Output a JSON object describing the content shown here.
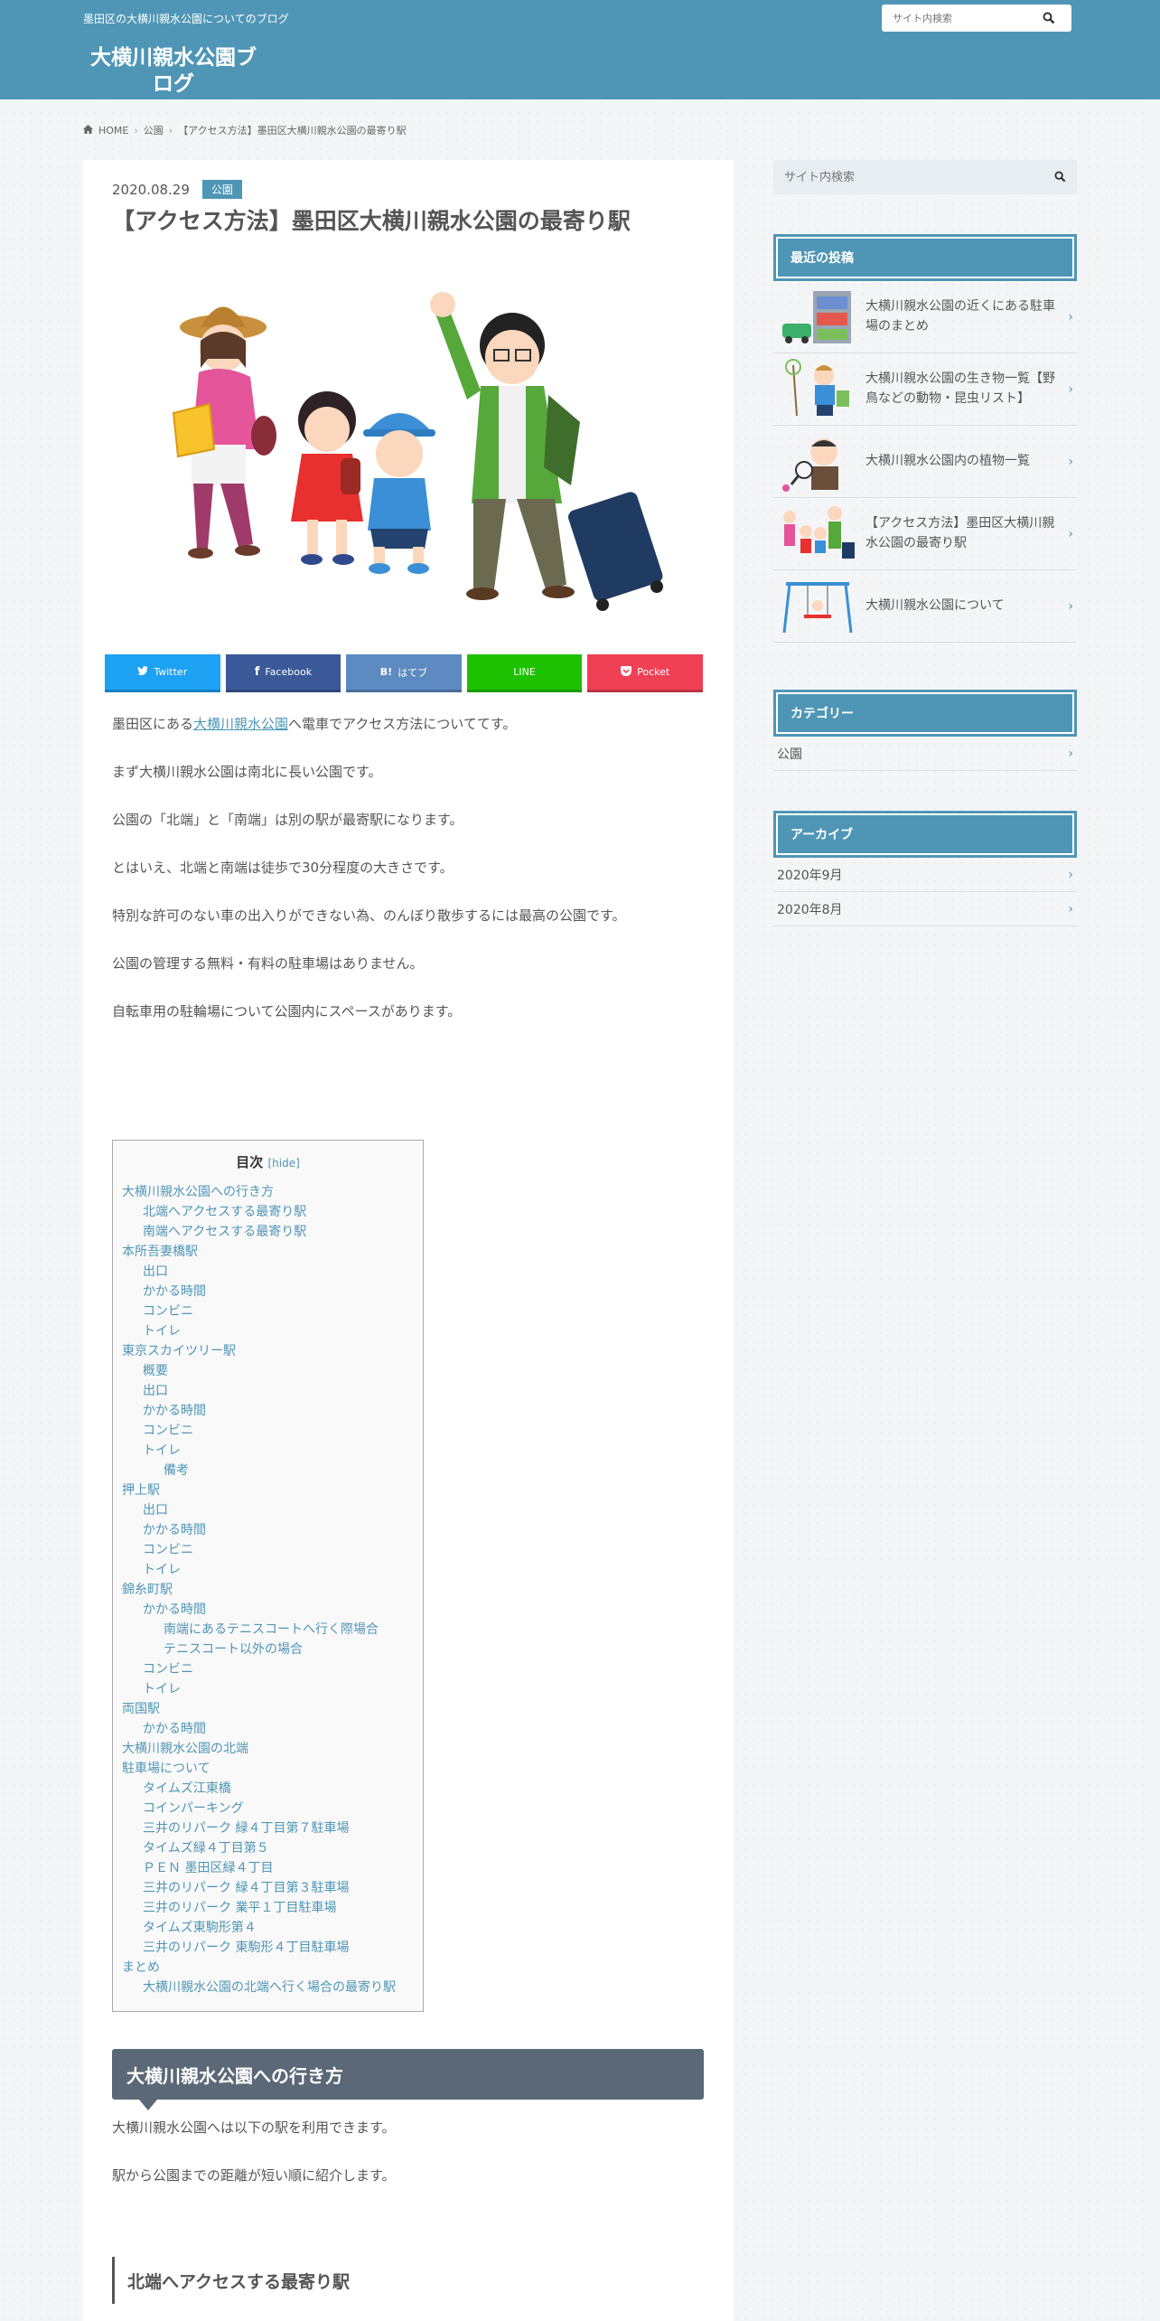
{
  "header": {
    "tagline": "墨田区の大横川親水公園についてのブログ",
    "site_title": "大横川親水公園ブログ",
    "search_placeholder": "サイト内検索"
  },
  "breadcrumb": {
    "home": "HOME",
    "category": "公園",
    "current": "【アクセス方法】墨田区大横川親水公園の最寄り駅"
  },
  "post": {
    "date": "2020.08.29",
    "category": "公園",
    "title": "【アクセス方法】墨田区大横川親水公園の最寄り駅"
  },
  "share": {
    "twitter": "Twitter",
    "facebook": "Facebook",
    "hatena": "はてブ",
    "hatena_mark": "B!",
    "line": "LINE",
    "pocket": "Pocket"
  },
  "intro": {
    "p1_before": "墨田区にある",
    "p1_link": "大横川親水公園",
    "p1_after": "へ電車でアクセス方法についててす。",
    "p2": "まず大横川親水公園は南北に長い公園です。",
    "p3": "公園の「北端」と「南端」は別の駅が最寄駅になります。",
    "p4": "とはいえ、北端と南端は徒歩で30分程度の大きさです。",
    "p5": "特別な許可のない車の出入りができない為、のんぼり散歩するには最高の公園です。",
    "p6": "公園の管理する無料・有料の駐車場はありません。",
    "p7": "自転車用の駐輪場について公園内にスペースがあります。"
  },
  "toc": {
    "title": "目次",
    "hide": "[hide]",
    "items": [
      {
        "label": "大横川親水公園への行き方",
        "level": 1
      },
      {
        "label": "北端へアクセスする最寄り駅",
        "level": 2
      },
      {
        "label": "南端へアクセスする最寄り駅",
        "level": 2
      },
      {
        "label": "本所吾妻橋駅",
        "level": 1
      },
      {
        "label": "出口",
        "level": 2
      },
      {
        "label": "かかる時間",
        "level": 2
      },
      {
        "label": "コンビニ",
        "level": 2
      },
      {
        "label": "トイレ",
        "level": 2
      },
      {
        "label": "東京スカイツリー駅",
        "level": 1
      },
      {
        "label": "概要",
        "level": 2
      },
      {
        "label": "出口",
        "level": 2
      },
      {
        "label": "かかる時間",
        "level": 2
      },
      {
        "label": "コンビニ",
        "level": 2
      },
      {
        "label": "トイレ",
        "level": 2
      },
      {
        "label": "備考",
        "level": 3
      },
      {
        "label": "押上駅",
        "level": 1
      },
      {
        "label": "出口",
        "level": 2
      },
      {
        "label": "かかる時間",
        "level": 2
      },
      {
        "label": "コンビニ",
        "level": 2
      },
      {
        "label": "トイレ",
        "level": 2
      },
      {
        "label": "錦糸町駅",
        "level": 1
      },
      {
        "label": "かかる時間",
        "level": 2
      },
      {
        "label": "南端にあるテニスコートへ行く際場合",
        "level": 3
      },
      {
        "label": "テニスコート以外の場合",
        "level": 3
      },
      {
        "label": "コンビニ",
        "level": 2
      },
      {
        "label": "トイレ",
        "level": 2
      },
      {
        "label": "両国駅",
        "level": 1
      },
      {
        "label": "かかる時間",
        "level": 2
      },
      {
        "label": "大横川親水公園の北端",
        "level": 1
      },
      {
        "label": "駐車場について",
        "level": 1
      },
      {
        "label": "タイムズ江東橋",
        "level": 2
      },
      {
        "label": "コインパーキング",
        "level": 2
      },
      {
        "label": "三井のリパーク 緑４丁目第７駐車場",
        "level": 2
      },
      {
        "label": "タイムズ緑４丁目第５",
        "level": 2
      },
      {
        "label": "ＰＥＮ 墨田区緑４丁目",
        "level": 2
      },
      {
        "label": "三井のリパーク 緑４丁目第３駐車場",
        "level": 2
      },
      {
        "label": "三井のリパーク 業平１丁目駐車場",
        "level": 2
      },
      {
        "label": "タイムズ東駒形第４",
        "level": 2
      },
      {
        "label": "三井のリパーク 東駒形４丁目駐車場",
        "level": 2
      },
      {
        "label": "まとめ",
        "level": 1
      },
      {
        "label": "大横川親水公園の北端へ行く場合の最寄り駅",
        "level": 2
      }
    ]
  },
  "section1": {
    "heading": "大横川親水公園への行き方",
    "p1": "大横川親水公園へは以下の駅を利用できます。",
    "p2": "駅から公園までの距離が短い順に紹介します。",
    "h3": "北端へアクセスする最寄り駅"
  },
  "sidebar": {
    "search_placeholder": "サイト内検索",
    "recent_title": "最近の投稿",
    "recent_posts": [
      "大横川親水公園の近くにある駐車場のまとめ",
      "大横川親水公園の生き物一覧【野鳥などの動物・昆虫リスト】",
      "大横川親水公園内の植物一覧",
      "【アクセス方法】墨田区大横川親水公園の最寄り駅",
      "大横川親水公園について"
    ],
    "category_title": "カテゴリー",
    "categories": [
      "公園"
    ],
    "archive_title": "アーカイブ",
    "archives": [
      "2020年9月",
      "2020年8月"
    ]
  },
  "colors": {
    "accent": "#4f96b6",
    "heading_dark": "#5a6877",
    "twitter": "#1da1f2",
    "facebook": "#3b5998",
    "hatena": "#5d8ac1",
    "line": "#1dc100",
    "pocket": "#ef4056"
  }
}
